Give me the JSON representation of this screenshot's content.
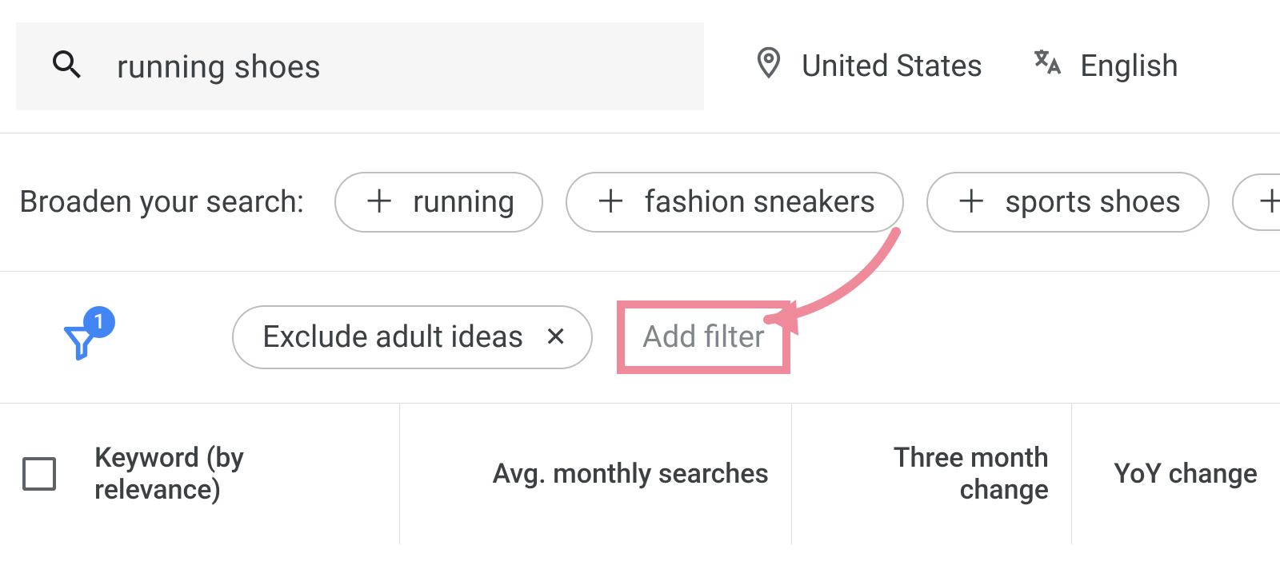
{
  "search": {
    "query": "running shoes"
  },
  "location": {
    "label": "United States"
  },
  "language": {
    "label": "English"
  },
  "broaden": {
    "label": "Broaden your search:",
    "chips": [
      "running",
      "fashion sneakers",
      "sports shoes"
    ]
  },
  "filters": {
    "badge_count": "1",
    "active_pill": "Exclude adult ideas",
    "add_filter_label": "Add filter"
  },
  "table": {
    "headers": {
      "keyword": "Keyword (by relevance)",
      "avg_searches": "Avg. monthly searches",
      "three_month": "Three month change",
      "yoy": "YoY change"
    }
  },
  "colors": {
    "accent_blue": "#4285f4",
    "annotation_pink": "#ef8a9b"
  }
}
